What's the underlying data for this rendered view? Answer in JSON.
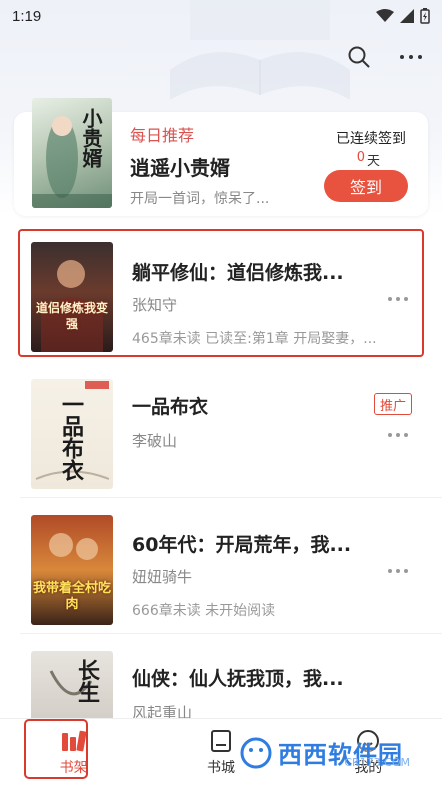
{
  "status_bar": {
    "time": "1:19"
  },
  "daily": {
    "tag": "每日推荐",
    "title": "逍遥小贵婿",
    "desc": "开局一首词，惊呆了...",
    "cover_text": "小贵婿",
    "streak_label": "已连续签到",
    "streak_count": "0",
    "streak_unit": "天",
    "checkin_label": "签到"
  },
  "books": [
    {
      "title": "躺平修仙：道侣修炼我...",
      "author": "张知守",
      "progress": "465章未读 已读至:第1章 开局娶妻，...",
      "cover_text": "道侣修炼我变强",
      "promo": ""
    },
    {
      "title": "一品布衣",
      "author": "李破山",
      "progress": "",
      "cover_text": "一品布衣",
      "promo": "推广"
    },
    {
      "title": "60年代：开局荒年，我...",
      "author": "妞妞骑牛",
      "progress": "666章未读 未开始阅读",
      "cover_text": "我带着全村吃肉",
      "promo": ""
    },
    {
      "title": "仙侠：仙人抚我顶，我...",
      "author": "风起重山",
      "progress": "",
      "cover_text": "长生",
      "promo": ""
    }
  ],
  "nav": {
    "shelf": "书架",
    "store": "书城",
    "me": "我的"
  },
  "watermark": {
    "main": "西西软件园",
    "sub": "CR173.COM"
  },
  "colors": {
    "accent": "#e24a3b",
    "highlight": "#d93a2e"
  }
}
